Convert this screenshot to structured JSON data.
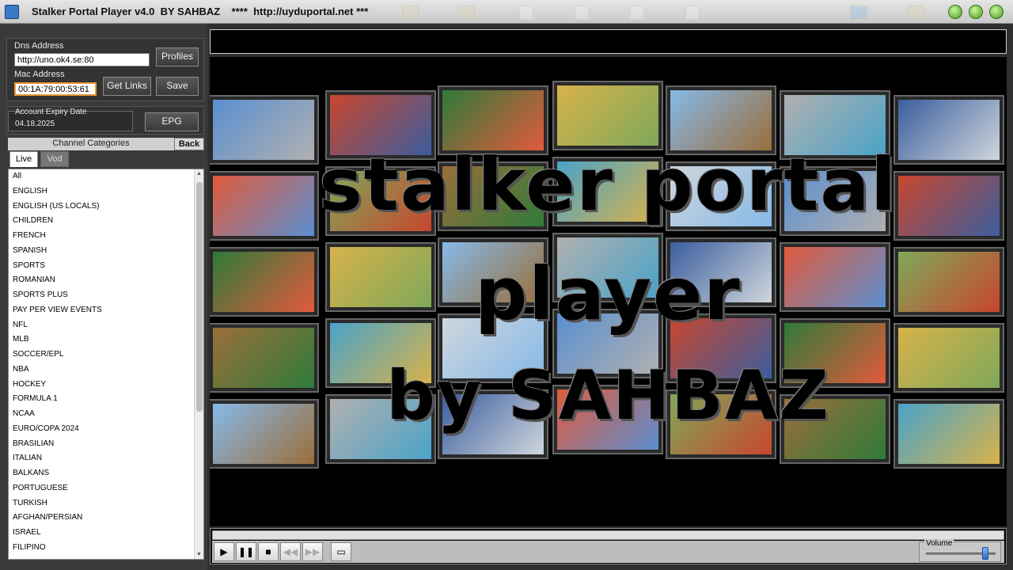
{
  "window": {
    "title": "Stalker Portal Player v4.0  BY SAHBAZ    ****  http://uyduportal.net ***"
  },
  "connection": {
    "dns_label": "Dns Address",
    "dns_value": "http://uno.ok4.se:80",
    "mac_label": "Mac Address",
    "mac_value": "00:1A:79:00:53:61",
    "profiles_label": "Profiles",
    "get_links_label": "Get Links",
    "save_label": "Save"
  },
  "account": {
    "expiry_label": "Account Expiry Date",
    "expiry_value": "04.18.2025",
    "epg_label": "EPG"
  },
  "categories": {
    "header": "Channel Categories",
    "back_label": "Back",
    "tabs": [
      "Live",
      "Vod"
    ],
    "items": [
      "All",
      "ENGLISH",
      "ENGLISH (US LOCALS)",
      "CHILDREN",
      "FRENCH",
      "SPANISH",
      "SPORTS",
      "ROMANIAN",
      "SPORTS PLUS",
      "PAY PER VIEW EVENTS",
      "NFL",
      "MLB",
      "SOCCER/EPL",
      "NBA",
      "HOCKEY",
      "FORMULA 1",
      "NCAA",
      "EURO/COPA 2024",
      "BRASILIAN",
      "ITALIAN",
      "BALKANS",
      "PORTUGUESE",
      "TURKISH",
      "AFGHAN/PERSIAN",
      "ISRAEL",
      "FILIPINO"
    ]
  },
  "video": {
    "overlay_line1": "stalker portal",
    "overlay_line2": "player",
    "overlay_line3": "by SAHBAZ"
  },
  "player": {
    "play_icon": "play-icon",
    "pause_icon": "pause-icon",
    "stop_icon": "stop-icon",
    "rewind_icon": "rewind-icon",
    "forward_icon": "forward-icon",
    "screen_icon": "screen-icon",
    "volume_label": "Volume",
    "volume_level": 0.85
  },
  "colors": {
    "panel": "#3a3a3a",
    "accent_volume": "#2a6fc8",
    "window_buttons": "#4a9a1e"
  }
}
